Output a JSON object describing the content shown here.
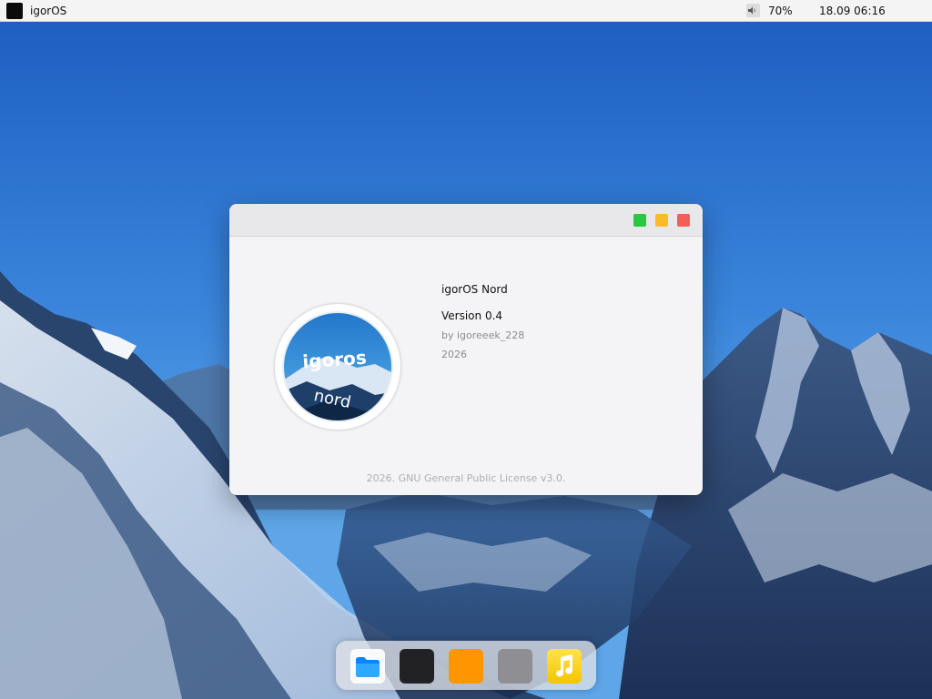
{
  "topbar": {
    "os_name": "igorOS",
    "volume": "70%",
    "datetime": "18.09 06:16",
    "icons": [
      "os-logo",
      "speaker-icon"
    ]
  },
  "about_window": {
    "logo_text_top": "igoros",
    "logo_text_bottom": "nord",
    "product_name": "igorOS Nord",
    "version": "Version 0.4",
    "author": "by igoreeek_228",
    "year": "2026",
    "license": "2026. GNU General Public License v3.0.",
    "buttons": [
      "maximize",
      "minimize",
      "close"
    ]
  },
  "dock": {
    "items": [
      "files-folder-icon",
      "terminal-icon",
      "orange-app-icon",
      "settings-icon",
      "music-note-icon"
    ]
  },
  "colors": {
    "window_bg": "#f4f4f6",
    "titlebar_bg": "#e8e8eb",
    "btn_green": "#2ac840",
    "btn_yellow": "#fbbb27",
    "btn_red": "#f25f57",
    "sky": "#2a6fc8"
  }
}
